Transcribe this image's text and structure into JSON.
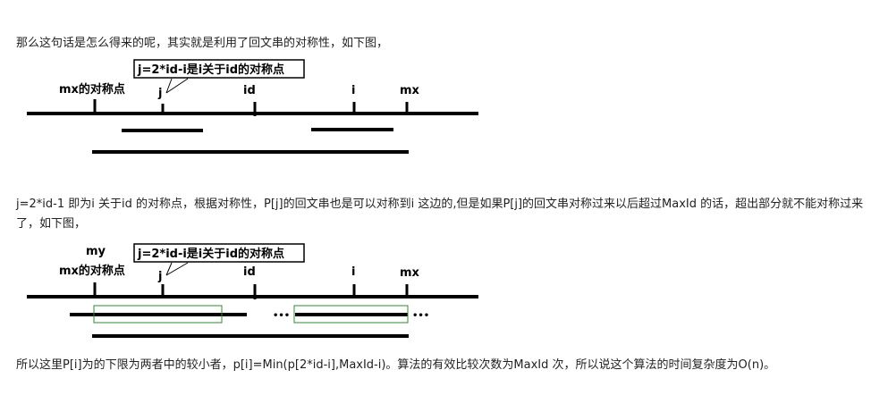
{
  "paragraphs": {
    "p1": "那么这句话是怎么得来的呢，其实就是利用了回文串的对称性，如下图，",
    "p2": "j=2*id-1 即为i 关于id 的对称点，根据对称性，P[j]的回文串也是可以对称到i 这边的,但是如果P[j]的回文串对称过来以后超过MaxId 的话，超出部分就不能对称过来了，如下图，",
    "p3": "所以这里P[i]为的下限为两者中的较小者，p[i]=Min(p[2*id-i],MaxId-i)。算法的有效比较次数为MaxId 次，所以说这个算法的时间复杂度为O(n)。"
  },
  "figure1": {
    "callout": "j=2*id-i是i关于id的对称点",
    "labels": {
      "mx_mirror": "mx的对称点",
      "j": "j",
      "id": "id",
      "i": "i",
      "mx": "mx"
    }
  },
  "figure2": {
    "callout": "j=2*id-i是i关于id的对称点",
    "labels": {
      "my": "my",
      "mx_mirror": "mx的对称点",
      "j": "j",
      "id": "id",
      "i": "i",
      "mx": "mx"
    },
    "ellipsis_left": "•••",
    "ellipsis_right": "•••"
  }
}
